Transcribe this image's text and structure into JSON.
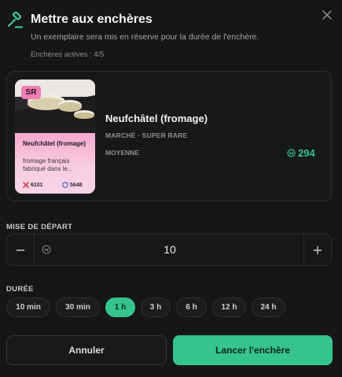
{
  "header": {
    "title": "Mettre aux enchères",
    "subtitle": "Un exemplaire sera mis en réserve pour la durée de l'enchère.",
    "active_auctions": "Enchères actives : 4/5",
    "icon": "gavel-icon",
    "close_icon": "close-icon"
  },
  "item": {
    "card": {
      "rarity_badge": "SR",
      "name": "Neufchâtel (fromage)",
      "description": "fromage français fabriqué dans le...",
      "stat_left": "6101",
      "stat_right": "5648"
    },
    "name": "Neufchâtel (fromage)",
    "meta": "MARCHÉ · SUPER RARE",
    "tier": "MOYENNE",
    "price": "294",
    "price_icon": "coin-icon"
  },
  "starting_bid": {
    "label": "MISE DE DÉPART",
    "value": "10",
    "minus_icon": "minus-icon",
    "plus_icon": "plus-icon",
    "coin_icon": "coin-icon"
  },
  "duration": {
    "label": "DURÉE",
    "options": [
      "10 min",
      "30 min",
      "1 h",
      "3 h",
      "6 h",
      "12 h",
      "24 h"
    ],
    "selected": "1 h"
  },
  "actions": {
    "cancel": "Annuler",
    "launch": "Lancer l'enchère"
  },
  "colors": {
    "accent": "#36c48e",
    "background": "#151617",
    "rarity_pink": "#ef7fb6"
  }
}
